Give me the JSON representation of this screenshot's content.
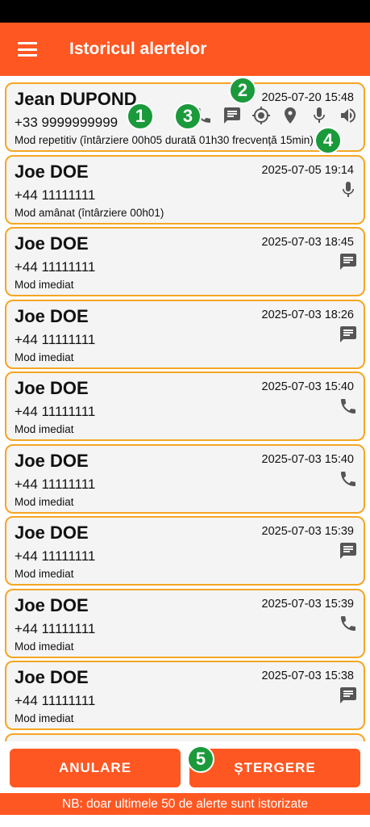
{
  "app": {
    "title": "Istoricul alertelor"
  },
  "alerts": [
    {
      "name": "Jean DUPOND",
      "phone": "+33 9999999999",
      "date": "2025-07-20 15:48",
      "mode": "Mod repetitiv (întârziere 00h05 durată 01h30 frecvență 15min)",
      "icons": [
        "phone-icon",
        "message-icon",
        "gps-icon",
        "location-pin-icon",
        "microphone-icon",
        "speaker-icon"
      ]
    },
    {
      "name": "Joe DOE",
      "phone": "+44 11111111",
      "date": "2025-07-05 19:14",
      "mode": "Mod amânat (întârziere 00h01)",
      "icons": [
        "microphone-icon"
      ]
    },
    {
      "name": "Joe DOE",
      "phone": "+44 11111111",
      "date": "2025-07-03 18:45",
      "mode": "Mod imediat",
      "icons": [
        "message-icon"
      ]
    },
    {
      "name": "Joe DOE",
      "phone": "+44 11111111",
      "date": "2025-07-03 18:26",
      "mode": "Mod imediat",
      "icons": [
        "message-icon"
      ]
    },
    {
      "name": "Joe DOE",
      "phone": "+44 11111111",
      "date": "2025-07-03 15:40",
      "mode": "Mod imediat",
      "icons": [
        "phone-icon"
      ]
    },
    {
      "name": "Joe DOE",
      "phone": "+44 11111111",
      "date": "2025-07-03 15:40",
      "mode": "Mod imediat",
      "icons": [
        "phone-icon"
      ]
    },
    {
      "name": "Joe DOE",
      "phone": "+44 11111111",
      "date": "2025-07-03 15:39",
      "mode": "Mod imediat",
      "icons": [
        "message-icon"
      ]
    },
    {
      "name": "Joe DOE",
      "phone": "+44 11111111",
      "date": "2025-07-03 15:39",
      "mode": "Mod imediat",
      "icons": [
        "phone-icon"
      ]
    },
    {
      "name": "Joe DOE",
      "phone": "+44 11111111",
      "date": "2025-07-03 15:38",
      "mode": "Mod imediat",
      "icons": [
        "message-icon"
      ]
    }
  ],
  "markers": [
    "1",
    "2",
    "3",
    "4",
    "5"
  ],
  "buttons": {
    "cancel": "ANULARE",
    "delete": "ȘTERGERE"
  },
  "footer": {
    "note": "NB: doar ultimele 50 de alerte sunt istorizate"
  },
  "colors": {
    "accent": "#ff5722",
    "card_border": "#f5a623",
    "marker": "#1b9a3c"
  }
}
